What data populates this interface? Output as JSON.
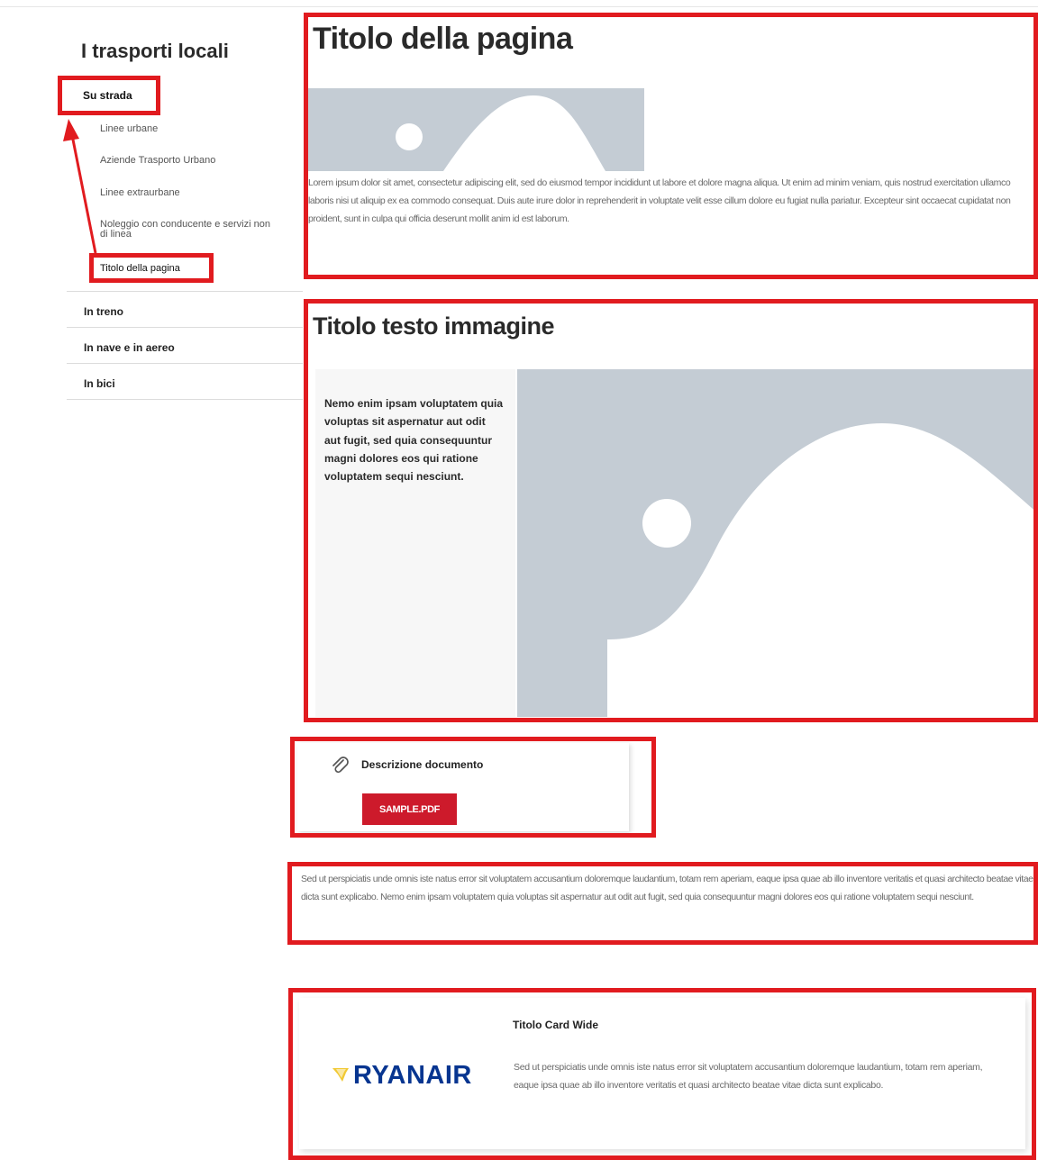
{
  "sidebar": {
    "title": "I trasporti locali",
    "active_section": "Su strada",
    "sub_items": [
      "Linee urbane",
      "Aziende Trasporto Urbano",
      "Linee extraurbane",
      "Noleggio con conducente e servizi non di linea"
    ],
    "current_page": "Titolo della pagina",
    "sections": [
      "In treno",
      "In nave e in aereo",
      "In bici"
    ]
  },
  "main": {
    "page_title": "Titolo della pagina",
    "intro_text": "Lorem ipsum dolor sit amet, consectetur adipiscing elit, sed do eiusmod tempor incididunt ut labore et dolore magna aliqua. Ut enim ad minim veniam, quis nostrud exercitation ullamco laboris nisi ut aliquip ex ea commodo consequat. Duis aute irure dolor in reprehenderit in voluptate velit esse cillum dolore eu fugiat nulla pariatur. Excepteur sint occaecat cupidatat non proident, sunt in culpa qui officia deserunt mollit anim id est laborum.",
    "text_image_title": "Titolo testo immagine",
    "text_image_body": "Nemo enim ipsam voluptatem quia voluptas sit aspernatur aut odit aut fugit, sed quia consequuntur magni dolores eos qui ratione voluptatem sequi nesciunt.",
    "document": {
      "icon": "paperclip-icon",
      "label": "Descrizione documento",
      "button_label": "SAMPLE.PDF"
    },
    "paragraph": "Sed ut perspiciatis unde omnis iste natus error sit voluptatem accusantium doloremque laudantium, totam rem aperiam, eaque ipsa quae ab illo inventore veritatis et quasi architecto beatae vitae dicta sunt explicabo. Nemo enim ipsam voluptatem quia voluptas sit aspernatur aut odit aut fugit, sed quia consequuntur magni dolores eos qui ratione voluptatem sequi nesciunt.",
    "wide_card": {
      "title": "Titolo Card Wide",
      "logo_text": "RYANAIR",
      "text": "Sed ut perspiciatis unde omnis iste natus error sit voluptatem accusantium doloremque laudantium, totam rem aperiam, eaque ipsa quae ab illo inventore veritatis et quasi architecto beatae vitae dicta sunt explicabo."
    }
  },
  "colors": {
    "annotation": "#e11b1f",
    "button": "#cd1a2b",
    "placeholder": "#c4ccd4",
    "logo": "#073590",
    "logo_accent": "#f1c933"
  }
}
